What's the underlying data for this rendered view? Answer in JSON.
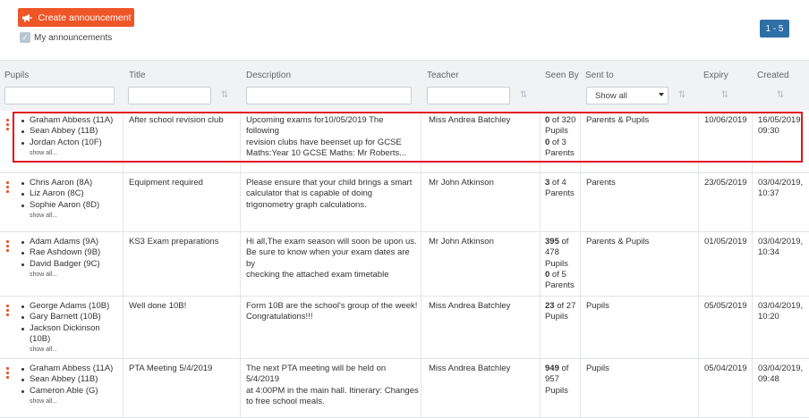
{
  "toolbar": {
    "create_label": "Create announcement",
    "my_announcements_label": "My announcements",
    "my_announcements_checked": true,
    "pager_label": "1 - 5"
  },
  "columns": {
    "pupils": "Pupils",
    "title": "Title",
    "description": "Description",
    "teacher": "Teacher",
    "seen_by": "Seen By",
    "sent_to": "Sent to",
    "expiry": "Expiry",
    "created": "Created"
  },
  "filters": {
    "sent_to_value": "Show all"
  },
  "rows": [
    {
      "pupils": [
        "Graham Abbess (11A)",
        "Sean Abbey (11B)",
        "Jordan Acton (10F)"
      ],
      "show_all": "show all...",
      "title": "After school revision club",
      "description": [
        "Upcoming exams for10/05/2019 The following",
        "revision clubs have beenset up for GCSE",
        "Maths:Year 10 GCSE Maths: Mr Roberts..."
      ],
      "teacher": "Miss Andrea Batchley",
      "seen": [
        {
          "n": "0",
          "rest": " of 320"
        },
        {
          "n": "",
          "rest": "Pupils"
        },
        {
          "n": "0",
          "rest": " of 3"
        },
        {
          "n": "",
          "rest": "Parents"
        }
      ],
      "sent_to": "Parents & Pupils",
      "expiry": "10/06/2019",
      "created": [
        "16/05/2019,",
        "09:30"
      ]
    },
    {
      "pupils": [
        "Chris Aaron (8A)",
        "Liz Aaron (8C)",
        "Sophie Aaron (8D)"
      ],
      "show_all": "show all...",
      "title": "Equipment required",
      "description": [
        "Please ensure that your child brings a smart",
        "calculator that is capable of doing",
        "trigonometry graph calculations."
      ],
      "teacher": "Mr John Atkinson",
      "seen": [
        {
          "n": "3",
          "rest": " of 4"
        },
        {
          "n": "",
          "rest": "Parents"
        }
      ],
      "sent_to": "Parents",
      "expiry": "23/05/2019",
      "created": [
        "03/04/2019,",
        "10:37"
      ]
    },
    {
      "pupils": [
        "Adam Adams (9A)",
        "Rae Ashdown (9B)",
        "David Badger (9C)"
      ],
      "show_all": "show all...",
      "title": "KS3 Exam preparations",
      "description": [
        "Hi all,The exam season will soon be upon us.",
        "Be sure to know when your exam dates are by",
        "checking the attached exam timetable"
      ],
      "teacher": "Mr John Atkinson",
      "seen": [
        {
          "n": "395",
          "rest": " of"
        },
        {
          "n": "",
          "rest": "478"
        },
        {
          "n": "",
          "rest": "Pupils"
        },
        {
          "n": "0",
          "rest": " of 5"
        },
        {
          "n": "",
          "rest": "Parents"
        }
      ],
      "sent_to": "Parents & Pupils",
      "expiry": "01/05/2019",
      "created": [
        "03/04/2019,",
        "10:34"
      ]
    },
    {
      "pupils": [
        "George Adams (10B)",
        "Gary Barnett (10B)",
        "Jackson Dickinson (10B)"
      ],
      "show_all": "show all...",
      "title": "Well done 10B!",
      "description": [
        "Form 10B are the school's group of the week!",
        "Congratulations!!!"
      ],
      "teacher": "Miss Andrea Batchley",
      "seen": [
        {
          "n": "23",
          "rest": " of 27"
        },
        {
          "n": "",
          "rest": "Pupils"
        }
      ],
      "sent_to": "Pupils",
      "expiry": "05/05/2019",
      "created": [
        "03/04/2019,",
        "10:20"
      ]
    },
    {
      "pupils": [
        "Graham Abbess (11A)",
        "Sean Abbey (11B)",
        "Cameron Able (G)"
      ],
      "show_all": "show all...",
      "title": "PTA Meeting 5/4/2019",
      "description": [
        "The next PTA meeting will be held on 5/4/2019",
        "at 4:00PM in the main hall. Itinerary: Changes",
        "to free school meals."
      ],
      "teacher": "Miss Andrea Batchley",
      "seen": [
        {
          "n": "949",
          "rest": " of"
        },
        {
          "n": "",
          "rest": "957"
        },
        {
          "n": "",
          "rest": "Pupils"
        }
      ],
      "sent_to": "Pupils",
      "expiry": "05/04/2019",
      "created": [
        "03/04/2019,",
        "09:48"
      ]
    }
  ]
}
